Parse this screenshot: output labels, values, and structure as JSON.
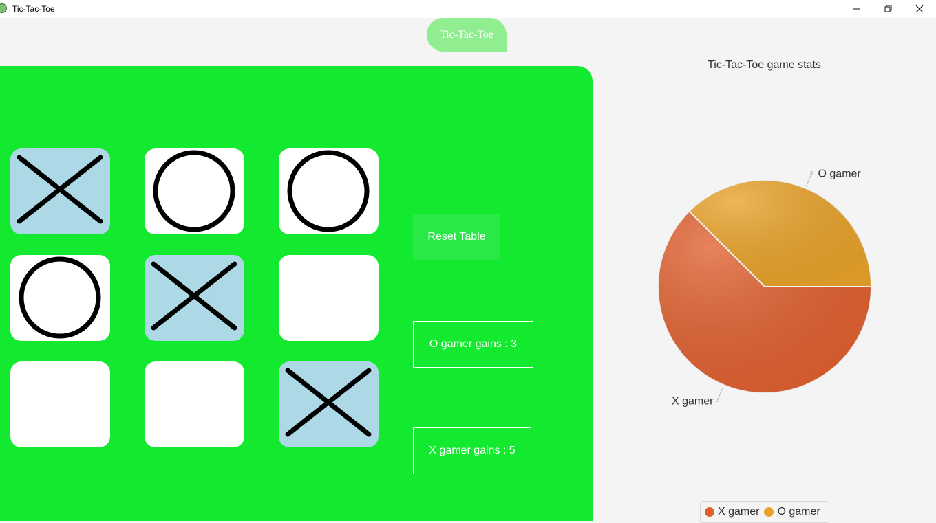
{
  "window": {
    "title": "Tic-Tac-Toe",
    "icons": {
      "minimize": "minimize-icon",
      "maximize": "restore-icon",
      "close": "close-icon"
    }
  },
  "header": {
    "label": "Tic-Tac-Toe"
  },
  "board": {
    "cells": [
      "X",
      "O",
      "O",
      "O",
      "X",
      "",
      "",
      "",
      "X"
    ],
    "colors": {
      "panel": "#13ea2f",
      "empty_cell": "#ffffff",
      "x_cell": "#add8e6",
      "mark": "#000000"
    }
  },
  "controls": {
    "reset_label": "Reset Table",
    "o_score_text": "O gamer gains : 3",
    "x_score_text": "X gamer gains : 5"
  },
  "chart_data": {
    "type": "pie",
    "title": "Tic-Tac-Toe game stats",
    "slices": [
      {
        "name": "X gamer",
        "value": 5,
        "color": "#e0602f"
      },
      {
        "name": "O gamer",
        "value": 3,
        "color": "#e8a22a"
      }
    ],
    "legend": [
      "X gamer",
      "O gamer"
    ],
    "legend_position": "bottom"
  }
}
